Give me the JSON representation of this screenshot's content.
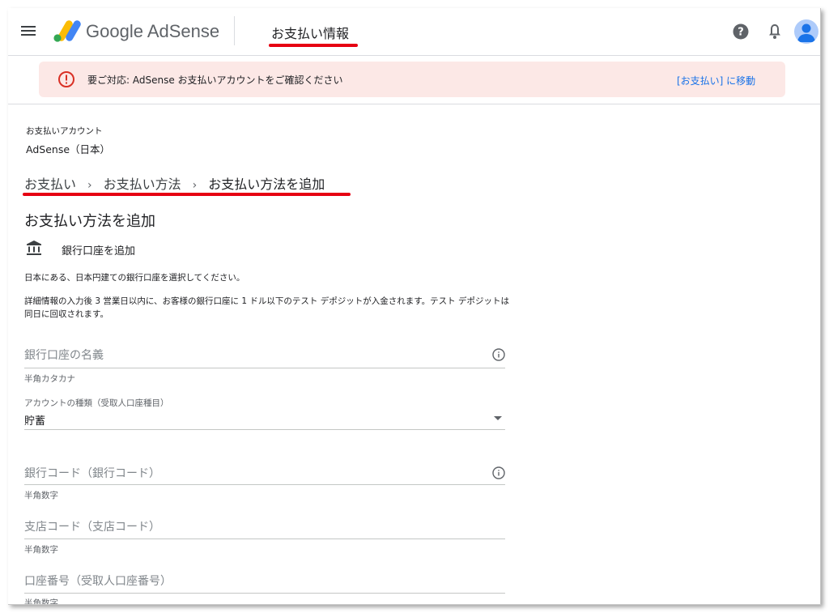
{
  "header": {
    "brand": "Google AdSense",
    "title": "お支払い情報"
  },
  "alert": {
    "text": "要ご対応: AdSense お支払いアカウントをご確認ください",
    "link": "[お支払い] に移動"
  },
  "account": {
    "label": "お支払いアカウント",
    "value": "AdSense（日本）"
  },
  "breadcrumb": {
    "items": [
      "お支払い",
      "お支払い方法",
      "お支払い方法を追加"
    ],
    "separator": "›"
  },
  "page": {
    "heading": "お支払い方法を追加",
    "bank_label": "銀行口座を追加",
    "desc1": "日本にある、日本円建ての銀行口座を選択してください。",
    "desc2": "詳細情報の入力後 3 営業日以内に、お客様の銀行口座に 1 ドル以下のテスト デポジットが入金されます。テスト デポジットは同日に回収されます。"
  },
  "form": {
    "account_name": {
      "placeholder": "銀行口座の名義",
      "hint": "半角カタカナ"
    },
    "account_type": {
      "label": "アカウントの種類（受取人口座種目）",
      "value": "貯蓄"
    },
    "bank_code": {
      "placeholder": "銀行コード（銀行コード）",
      "hint": "半角数字"
    },
    "branch_code": {
      "placeholder": "支店コード（支店コード）",
      "hint": "半角数字"
    },
    "account_number": {
      "placeholder": "口座番号（受取人口座番号）",
      "hint": "半角数字"
    }
  },
  "colors": {
    "accent_red": "#e60012",
    "alert_bg": "#fce8e6",
    "link_blue": "#1a73e8"
  }
}
